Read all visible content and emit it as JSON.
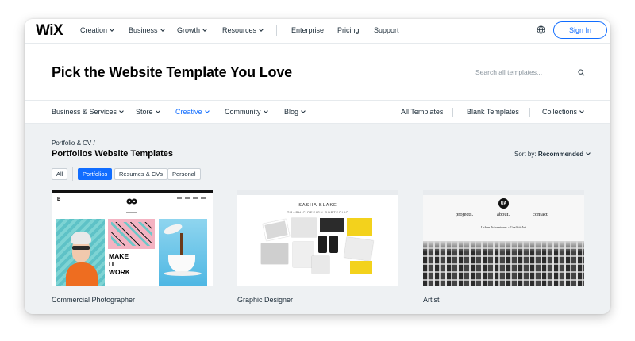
{
  "brand": {
    "logo": "WiX"
  },
  "topnav": {
    "items": [
      {
        "label": "Creation",
        "has_dropdown": true
      },
      {
        "label": "Business",
        "has_dropdown": true
      },
      {
        "label": "Growth",
        "has_dropdown": true
      },
      {
        "label": "Resources",
        "has_dropdown": true
      },
      {
        "label": "Enterprise",
        "has_dropdown": false
      },
      {
        "label": "Pricing",
        "has_dropdown": false
      },
      {
        "label": "Support",
        "has_dropdown": false
      }
    ],
    "globe_icon": "globe-icon",
    "sign_in": "Sign In"
  },
  "hero": {
    "title": "Pick the Website Template You Love",
    "search_placeholder": "Search all templates..."
  },
  "catnav": {
    "left": [
      {
        "label": "Business & Services",
        "active": false
      },
      {
        "label": "Store",
        "active": false
      },
      {
        "label": "Creative",
        "active": true
      },
      {
        "label": "Community",
        "active": false
      },
      {
        "label": "Blog",
        "active": false
      }
    ],
    "right": [
      {
        "label": "All Templates",
        "has_dropdown": false
      },
      {
        "label": "Blank Templates",
        "has_dropdown": false
      },
      {
        "label": "Collections",
        "has_dropdown": true
      }
    ]
  },
  "content": {
    "breadcrumb": "Portfolio & CV /",
    "title": "Portfolios Website Templates",
    "sort_label": "Sort by:",
    "sort_value": "Recommended",
    "filters": [
      {
        "label": "All",
        "active": false
      },
      {
        "label": "Portfolios",
        "active": true
      },
      {
        "label": "Resumes & CVs",
        "active": false
      },
      {
        "label": "Personal",
        "active": false
      }
    ]
  },
  "cards": [
    {
      "label": "Commercial Photographer",
      "thumb": {
        "logo": "B",
        "headline": [
          "MAKE",
          "IT",
          "WORK"
        ]
      }
    },
    {
      "label": "Graphic Designer",
      "thumb": {
        "name": "SASHA BLAKE",
        "subtitle": "GRAPHIC DESIGN PORTFOLIO"
      }
    },
    {
      "label": "Artist",
      "thumb": {
        "badge": "UA",
        "nav": [
          "projects.",
          "about.",
          "contact."
        ],
        "caption": "Urban Adventures - Graffiti Art"
      }
    }
  ],
  "colors": {
    "accent": "#116dff",
    "text": "#20303c",
    "bg": "#eef1f3"
  }
}
